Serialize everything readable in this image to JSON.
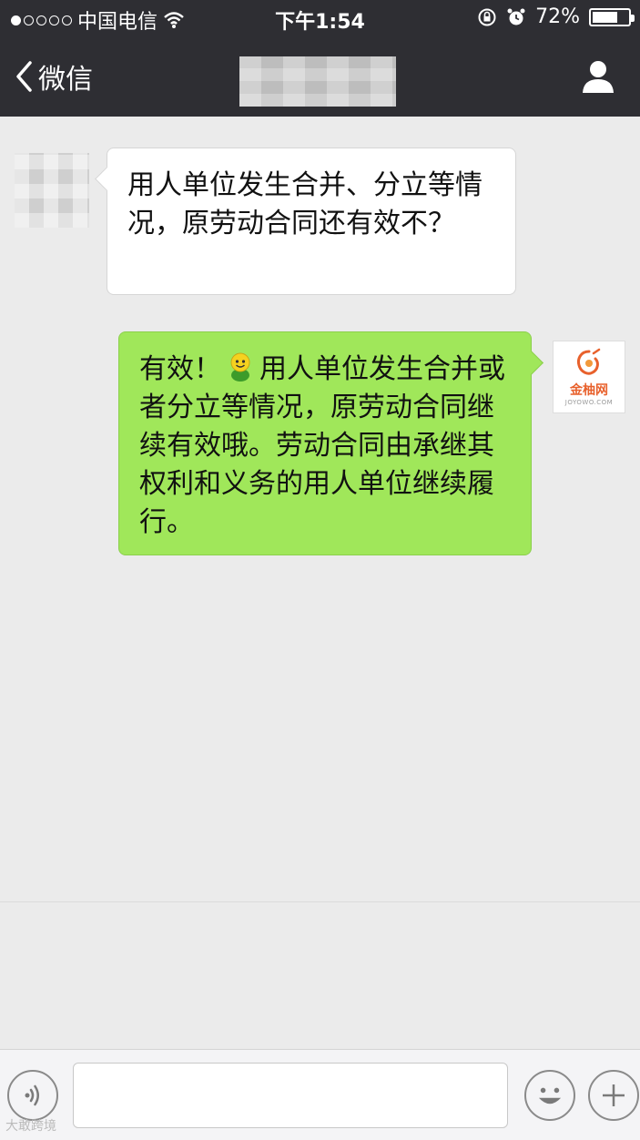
{
  "status_bar": {
    "carrier": "中国电信",
    "time": "下午1:54",
    "battery": "72%",
    "battery_level": 0.72,
    "signal_bars_filled": 1,
    "signal_bars_total": 5
  },
  "nav": {
    "back_label": "微信"
  },
  "messages": [
    {
      "direction": "incoming",
      "text": "用人单位发生合并、分立等情况，原劳动合同还有效不？"
    },
    {
      "direction": "outgoing",
      "text_before_emoji": "有效！",
      "emoji": "smiley-sprite",
      "text_after_emoji": "用人单位发生合并或者分立等情况，原劳动合同继续有效哦。劳动合同由承继其权利和义务的用人单位继续履行。",
      "sender_avatar": {
        "name": "金柚网",
        "domain": "JOYOWO.COM"
      }
    }
  ],
  "input_bar": {
    "value": "",
    "placeholder": ""
  },
  "watermark": "大敢跨境",
  "colors": {
    "nav_bg": "#2e2e33",
    "chat_bg": "#ebebeb",
    "outgoing_bubble": "#a0e75a",
    "incoming_bubble": "#ffffff"
  }
}
